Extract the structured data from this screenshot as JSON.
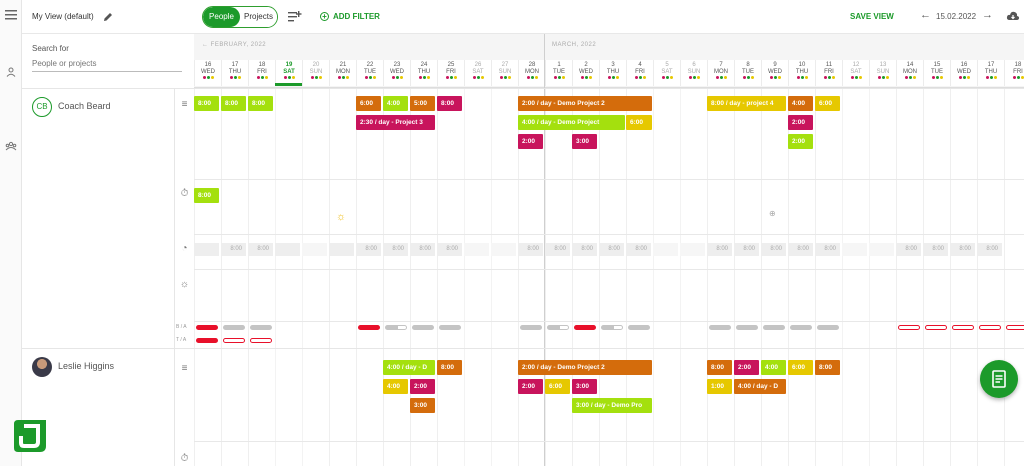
{
  "topbar": {
    "view_label": "My View (default)",
    "toggle_people": "People",
    "toggle_projects": "Projects",
    "add_filter": "ADD FILTER",
    "save_view": "SAVE VIEW",
    "date": "15.02.2022"
  },
  "search": {
    "label": "Search for",
    "placeholder": "People or projects"
  },
  "months": {
    "feb": "FEBRUARY, 2022",
    "mar": "MARCH, 2022"
  },
  "days": [
    {
      "n": "16",
      "w": "WED"
    },
    {
      "n": "17",
      "w": "THU"
    },
    {
      "n": "18",
      "w": "FRI"
    },
    {
      "n": "19",
      "w": "SAT"
    },
    {
      "n": "20",
      "w": "SUN"
    },
    {
      "n": "21",
      "w": "MON"
    },
    {
      "n": "22",
      "w": "TUE"
    },
    {
      "n": "23",
      "w": "WED"
    },
    {
      "n": "24",
      "w": "THU"
    },
    {
      "n": "25",
      "w": "FRI"
    },
    {
      "n": "26",
      "w": "SAT"
    },
    {
      "n": "27",
      "w": "SUN"
    },
    {
      "n": "28",
      "w": "MON"
    },
    {
      "n": "1",
      "w": "TUE"
    },
    {
      "n": "2",
      "w": "WED"
    },
    {
      "n": "3",
      "w": "THU"
    },
    {
      "n": "4",
      "w": "FRI"
    },
    {
      "n": "5",
      "w": "SAT"
    },
    {
      "n": "6",
      "w": "SUN"
    },
    {
      "n": "7",
      "w": "MON"
    },
    {
      "n": "8",
      "w": "TUE"
    },
    {
      "n": "9",
      "w": "WED"
    },
    {
      "n": "10",
      "w": "THU"
    },
    {
      "n": "11",
      "w": "FRI"
    },
    {
      "n": "12",
      "w": "SAT"
    },
    {
      "n": "13",
      "w": "SUN"
    },
    {
      "n": "14",
      "w": "MON"
    },
    {
      "n": "15",
      "w": "TUE"
    },
    {
      "n": "16",
      "w": "WED"
    },
    {
      "n": "17",
      "w": "THU"
    },
    {
      "n": "18",
      "w": "FRI"
    }
  ],
  "people": [
    {
      "name": "Coach Beard",
      "initials": "CB",
      "row_labels": [
        "B / A",
        "T / A"
      ]
    },
    {
      "name": "Leslie Higgins"
    }
  ],
  "colors": {
    "green": "#1c9a2a",
    "lime": "#a4e00e",
    "orange": "#d46c0c",
    "magenta": "#c8145c",
    "yellow": "#e6c800"
  },
  "bookings": {
    "cb_plan": [
      {
        "t": "8:00",
        "c": "lime"
      },
      {
        "t": "8:00",
        "c": "lime"
      },
      {
        "t": "8:00",
        "c": "lime"
      },
      {
        "t": "6:00",
        "c": "orange"
      },
      {
        "t": "4:00",
        "c": "lime"
      },
      {
        "t": "5:00",
        "c": "orange"
      },
      {
        "t": "8:00",
        "c": "magenta"
      },
      {
        "t": "2:00 / day - Demo Project 2",
        "c": "orange"
      },
      {
        "t": "8:00 / day - project 4",
        "c": "yellow"
      },
      {
        "t": "4:00",
        "c": "orange"
      },
      {
        "t": "6:00",
        "c": "yellow"
      },
      {
        "t": "2:30 / day - Project 3",
        "c": "magenta"
      },
      {
        "t": "4:00 / day - Demo Project",
        "c": "lime"
      },
      {
        "t": "6:00",
        "c": "yellow"
      },
      {
        "t": "2:00",
        "c": "magenta"
      },
      {
        "t": "2:00",
        "c": "magenta"
      },
      {
        "t": "3:00",
        "c": "magenta"
      },
      {
        "t": "2:00",
        "c": "lime"
      }
    ],
    "cb_time": "8:00",
    "grey": "8:00",
    "lh": [
      {
        "t": "4:00 / day - D",
        "c": "lime"
      },
      {
        "t": "8:00",
        "c": "orange"
      },
      {
        "t": "2:00 / day - Demo Project 2",
        "c": "orange"
      },
      {
        "t": "8:00",
        "c": "orange"
      },
      {
        "t": "2:00",
        "c": "magenta"
      },
      {
        "t": "4:00",
        "c": "lime"
      },
      {
        "t": "6:00",
        "c": "yellow"
      },
      {
        "t": "8:00",
        "c": "orange"
      },
      {
        "t": "4:00",
        "c": "yellow"
      },
      {
        "t": "2:00",
        "c": "magenta"
      },
      {
        "t": "2:00",
        "c": "magenta"
      },
      {
        "t": "6:00",
        "c": "yellow"
      },
      {
        "t": "3:00",
        "c": "magenta"
      },
      {
        "t": "1:00",
        "c": "yellow"
      },
      {
        "t": "4:00 / day - D",
        "c": "orange"
      },
      {
        "t": "3:00",
        "c": "orange"
      },
      {
        "t": "3:00 / day - Demo Pro",
        "c": "lime"
      }
    ]
  }
}
